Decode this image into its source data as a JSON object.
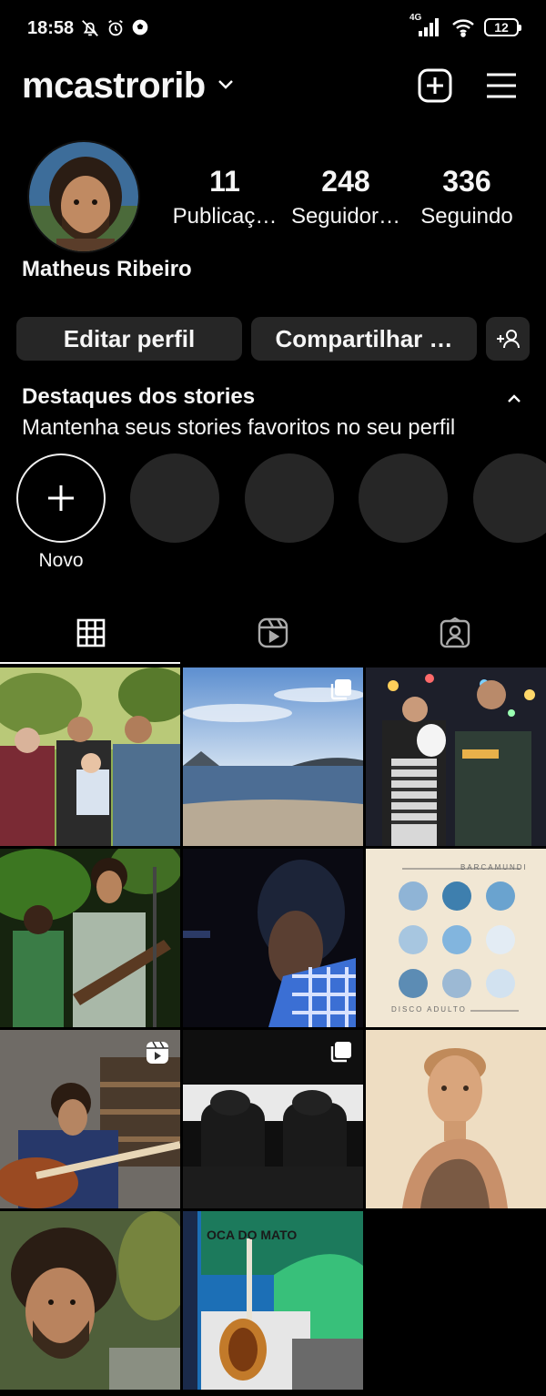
{
  "status_bar": {
    "time": "18:58",
    "network": "4G",
    "battery": "12",
    "icons": [
      "bell-off-icon",
      "alarm-icon",
      "soccer-ball-icon",
      "signal-icon",
      "wifi-icon",
      "battery-icon"
    ]
  },
  "header": {
    "username": "mcastrorib",
    "icons": [
      "chevron-down-icon",
      "plus-square-icon",
      "hamburger-menu-icon"
    ]
  },
  "profile": {
    "display_name": "Matheus Ribeiro",
    "stats": [
      {
        "value": "11",
        "label": "Publicaç…"
      },
      {
        "value": "248",
        "label": "Seguidor…"
      },
      {
        "value": "336",
        "label": "Seguindo"
      }
    ]
  },
  "actions": {
    "edit_label": "Editar perfil",
    "share_label": "Compartilhar …",
    "discover_icon": "add-person-icon"
  },
  "highlights": {
    "title": "Destaques dos stories",
    "subtitle": "Mantenha seus stories favoritos no seu perfil",
    "new_label": "Novo",
    "placeholder_count": 4
  },
  "tabs": [
    {
      "name": "grid",
      "icon": "grid-icon",
      "active": true
    },
    {
      "name": "reels",
      "icon": "reels-icon",
      "active": false
    },
    {
      "name": "tagged",
      "icon": "tagged-person-icon",
      "active": false
    }
  ],
  "posts": [
    {
      "description": "family-outdoors",
      "badge": ""
    },
    {
      "description": "sea-view",
      "badge": "carousel"
    },
    {
      "description": "fair-night",
      "badge": ""
    },
    {
      "description": "band-concert",
      "badge": ""
    },
    {
      "description": "portrait-dark",
      "badge": ""
    },
    {
      "description": "album-cover-barcamundi",
      "badge": ""
    },
    {
      "description": "guitar-playing",
      "badge": "reel"
    },
    {
      "description": "car-interior",
      "badge": "carousel"
    },
    {
      "description": "child-portrait",
      "badge": ""
    },
    {
      "description": "selfie-nature",
      "badge": ""
    },
    {
      "description": "guitar-stage",
      "badge": ""
    }
  ],
  "album_cover_text": {
    "top": "BARCAMUNDI",
    "bottom": "DISCO ADULTO"
  },
  "stage_banner_text": "OCA DO MATO",
  "colors": {
    "background": "#000000",
    "button": "#262626",
    "text": "#f5f5f5"
  }
}
